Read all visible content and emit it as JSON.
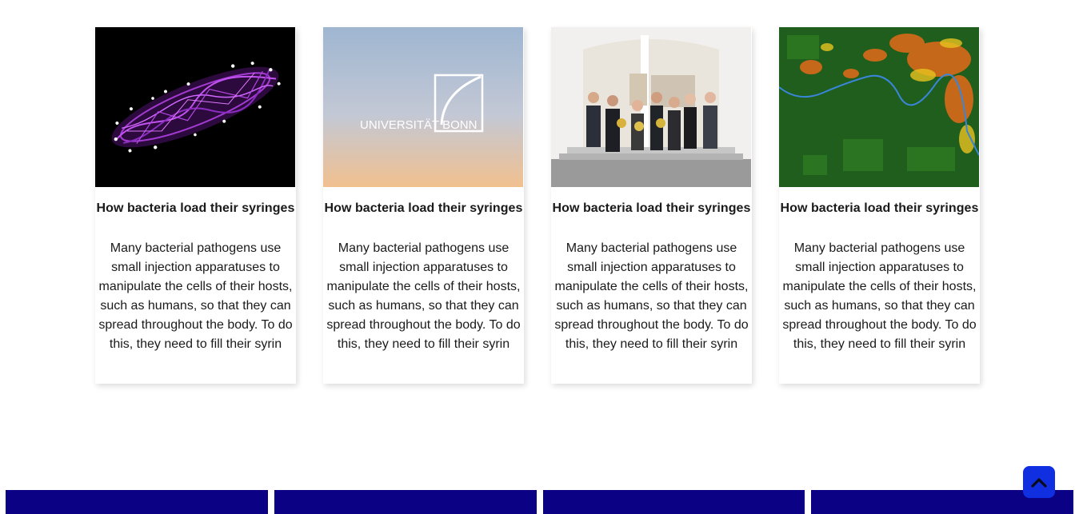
{
  "news": {
    "cards": [
      {
        "image_alt": "bacteria-microscopy-image",
        "title": "How bacteria load their syringes",
        "text": "Many bacterial pathogens use small injection apparatuses to manipulate the cells of their hosts, such as humans, so that they can spread throughout the body. To do this, they need to fill their syrin"
      },
      {
        "image_alt": "university-bonn-logo-image",
        "logo_text": "UNIVERSITÄT BONN",
        "title": "How bacteria load their syringes",
        "text": "Many bacterial pathogens use small injection apparatuses to manipulate the cells of their hosts, such as humans, so that they can spread throughout the body. To do this, they need to fill their syrin"
      },
      {
        "image_alt": "group-photo-image",
        "title": "How bacteria load their syringes",
        "text": "Many bacterial pathogens use small injection apparatuses to manipulate the cells of their hosts, such as humans, so that they can spread throughout the body. To do this, they need to fill their syrin"
      },
      {
        "image_alt": "satellite-map-image",
        "title": "How bacteria load their syringes",
        "text": "Many bacterial pathogens use small injection apparatuses to manipulate the cells of their hosts, such as humans, so that they can spread throughout the body. To do this, they need to fill their syrin"
      }
    ]
  },
  "back_to_top": {
    "icon": "chevron-up-icon"
  },
  "colors": {
    "footer_block": "#0b0184",
    "back_to_top": "#0f2fe0",
    "card_background": "#ffffff"
  }
}
